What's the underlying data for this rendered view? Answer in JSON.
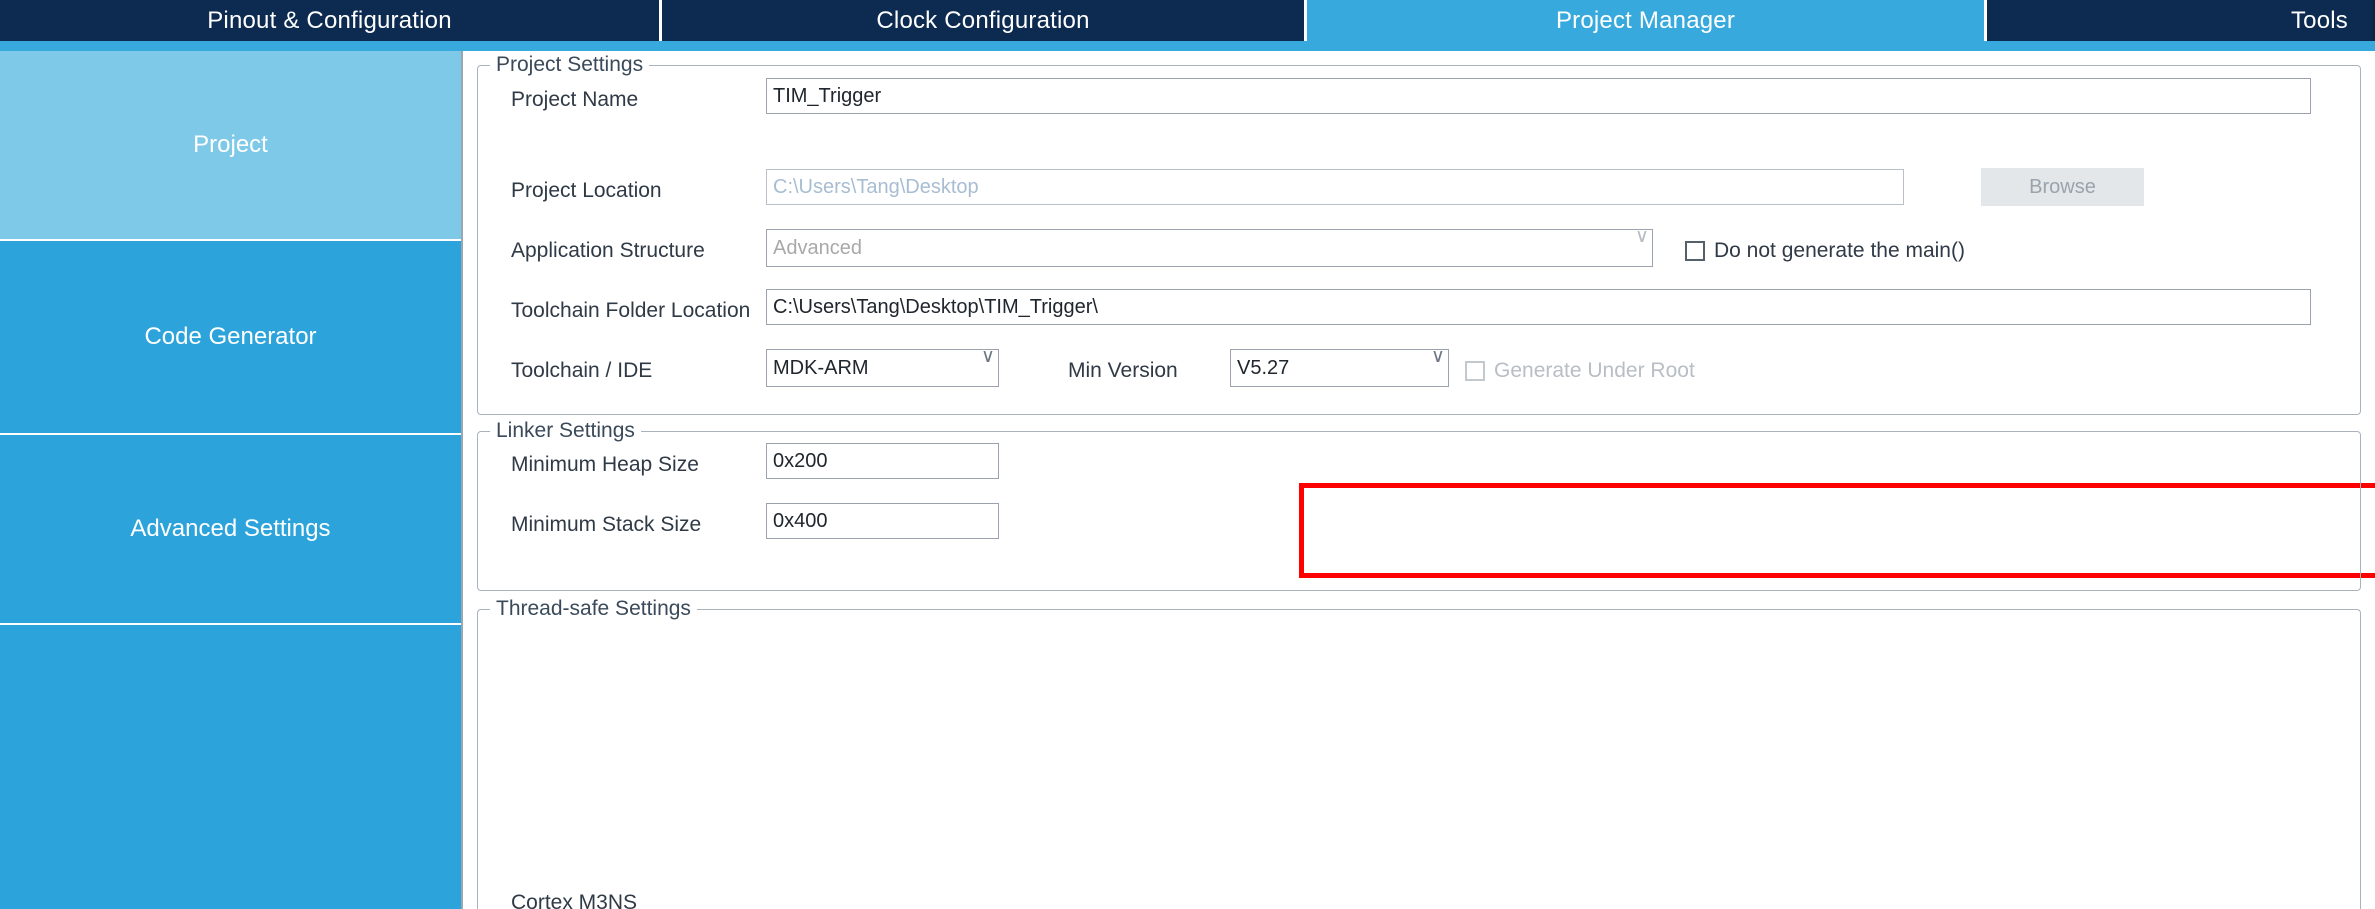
{
  "tabs": [
    {
      "label": "Pinout & Configuration",
      "active": false
    },
    {
      "label": "Clock Configuration",
      "active": false
    },
    {
      "label": "Project Manager",
      "active": true
    },
    {
      "label": "Tools",
      "active": false
    }
  ],
  "sidebar": {
    "items": [
      {
        "label": "Project",
        "active": true
      },
      {
        "label": "Code Generator",
        "active": false
      },
      {
        "label": "Advanced Settings",
        "active": false
      },
      {
        "label": "",
        "active": false
      }
    ]
  },
  "project_settings": {
    "group_title": "Project Settings",
    "project_name": {
      "label": "Project Name",
      "value": "TIM_Trigger"
    },
    "project_location": {
      "label": "Project Location",
      "value": "C:\\Users\\Tang\\Desktop",
      "browse_label": "Browse"
    },
    "application_structure": {
      "label": "Application Structure",
      "value": "Advanced",
      "no_main_label": "Do not generate the main()",
      "no_main_checked": false
    },
    "toolchain_folder_location": {
      "label": "Toolchain Folder Location",
      "value": "C:\\Users\\Tang\\Desktop\\TIM_Trigger\\"
    },
    "toolchain_ide": {
      "label": "Toolchain / IDE",
      "value": "MDK-ARM",
      "min_version_label": "Min Version",
      "min_version_value": "V5.27",
      "generate_under_root_label": "Generate Under Root",
      "generate_under_root_checked": false
    }
  },
  "linker_settings": {
    "group_title": "Linker Settings",
    "min_heap": {
      "label": "Minimum Heap Size",
      "value": "0x200"
    },
    "min_stack": {
      "label": "Minimum Stack Size",
      "value": "0x400"
    }
  },
  "thread_safe_settings": {
    "group_title": "Thread-safe Settings",
    "cortex_label": "Cortex M3NS"
  },
  "colors": {
    "tab_inactive": "#0d2a50",
    "tab_active": "#38a9dd",
    "sidebar": "#2ca3db",
    "sidebar_active": "#7ec8e8",
    "highlight": "#ff0000"
  }
}
